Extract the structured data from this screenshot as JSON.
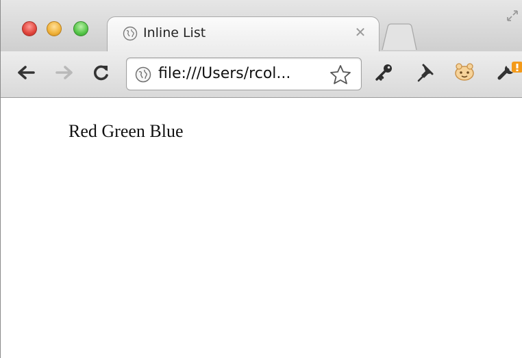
{
  "tab": {
    "title": "Inline List"
  },
  "omnibox": {
    "url": "file:///Users/rcol..."
  },
  "page": {
    "list_items": [
      "Red",
      "Green",
      "Blue"
    ]
  },
  "icons": {
    "window_controls": [
      "close-icon",
      "minimize-icon",
      "zoom-icon"
    ],
    "toolbar": [
      "back-icon",
      "forward-icon",
      "reload-icon",
      "globe-icon",
      "bookmark-star-icon",
      "key-icon",
      "pin-icon",
      "extension-face-icon",
      "wrench-icon"
    ]
  },
  "colors": {
    "close": "#e0443b",
    "minimize": "#f0b23a",
    "zoom": "#55c548",
    "wrench_badge": "#f39a1a"
  }
}
